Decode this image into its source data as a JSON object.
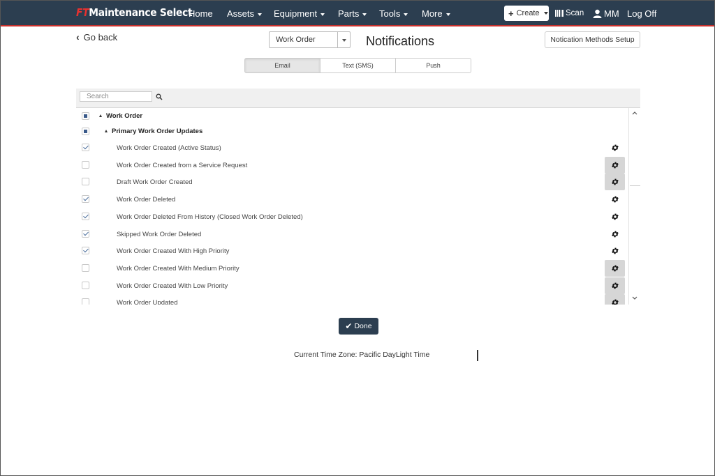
{
  "navbar": {
    "brand_prefix": "FT",
    "brand_name": "Maintenance Select",
    "items": [
      "Home",
      "Assets",
      "Equipment",
      "Parts",
      "Tools",
      "More"
    ],
    "create_label": "Create",
    "scan_label": "Scan",
    "user_initials": "MM",
    "logoff_label": "Log Off"
  },
  "header": {
    "go_back_label": "Go back",
    "category_select_value": "Work Order",
    "page_title": "Notifications",
    "methods_button_label": "Notication Methods Setup"
  },
  "tabs": [
    {
      "label": "Email",
      "active": true
    },
    {
      "label": "Text (SMS)",
      "active": false
    },
    {
      "label": "Push",
      "active": false
    }
  ],
  "search": {
    "placeholder": "Search"
  },
  "tree": {
    "root_label": "Work Order",
    "group_label": "Primary Work Order Updates",
    "items": [
      {
        "label": "Work Order Created (Active Status)",
        "checked": true
      },
      {
        "label": "Work Order Created from a Service Request",
        "checked": false
      },
      {
        "label": "Draft Work Order Created",
        "checked": false
      },
      {
        "label": "Work Order Deleted",
        "checked": true
      },
      {
        "label": "Work Order Deleted From History (Closed Work Order Deleted)",
        "checked": true
      },
      {
        "label": "Skipped Work Order Deleted",
        "checked": true
      },
      {
        "label": "Work Order Created With High Priority",
        "checked": true
      },
      {
        "label": "Work Order Created With Medium Priority",
        "checked": false
      },
      {
        "label": "Work Order Created With Low Priority",
        "checked": false
      },
      {
        "label": "Work Order Updated",
        "checked": false
      }
    ]
  },
  "footer": {
    "done_label": "Done",
    "timezone_text": "Current Time Zone: Pacific DayLight Time"
  },
  "colors": {
    "navbar_bg": "#2c3e50",
    "accent_red": "#e8312f",
    "done_bg": "#2c3e50"
  }
}
